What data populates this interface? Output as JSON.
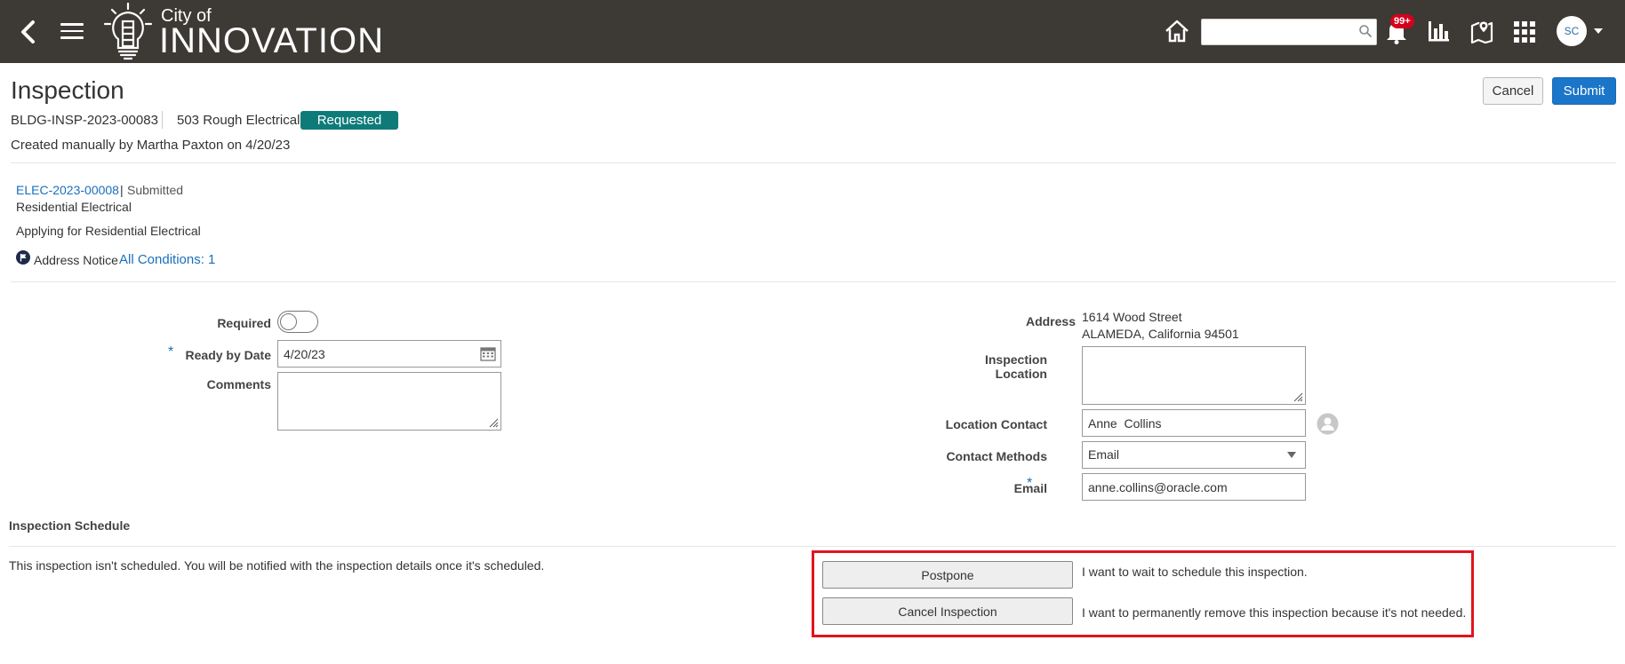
{
  "header": {
    "logo_city": "City of",
    "logo_name": "INNOVATION",
    "search_placeholder": "",
    "notification_badge": "99+",
    "user_initials": "SC"
  },
  "page": {
    "title": "Inspection",
    "cancel_label": "Cancel",
    "submit_label": "Submit",
    "inspection_id": "BLDG-INSP-2023-00083",
    "inspection_type": "503 Rough Electrical",
    "status": "Requested",
    "created_text": "Created manually by Martha Paxton on 4/20/23"
  },
  "permit": {
    "id": "ELEC-2023-00008",
    "separator": "|",
    "status": "Submitted",
    "type": "Residential Electrical",
    "description": "Applying for Residential Electrical",
    "notice_label": "Address Notice",
    "conditions_link": "All Conditions: 1"
  },
  "form": {
    "required_label": "Required",
    "required_on": false,
    "ready_by_label": "Ready by Date",
    "ready_by_value": "4/20/23",
    "comments_label": "Comments",
    "comments_value": "",
    "address_label": "Address",
    "address_line1": "1614 Wood Street",
    "address_line2": "ALAMEDA, California 94501",
    "inspection_location_label": "Inspection Location",
    "inspection_location_value": "",
    "location_contact_label": "Location Contact",
    "location_contact_value": "Anne  Collins",
    "contact_methods_label": "Contact Methods",
    "contact_methods_value": "Email",
    "email_label": "Email",
    "email_value": "anne.collins@oracle.com",
    "required_marker": "*"
  },
  "schedule": {
    "heading": "Inspection Schedule",
    "message": "This inspection isn't scheduled. You will be notified with the inspection details once it's scheduled.",
    "postpone_label": "Postpone",
    "postpone_desc": "I want to wait to schedule this inspection.",
    "cancel_inspection_label": "Cancel Inspection",
    "cancel_inspection_desc": "I want to permanently remove this inspection because it's not needed."
  },
  "colors": {
    "header_bg": "#3d3935",
    "status_pill": "#0f7b79",
    "link": "#1a6fbc",
    "primary_button": "#1b75c9",
    "highlight": "#e0141e"
  }
}
